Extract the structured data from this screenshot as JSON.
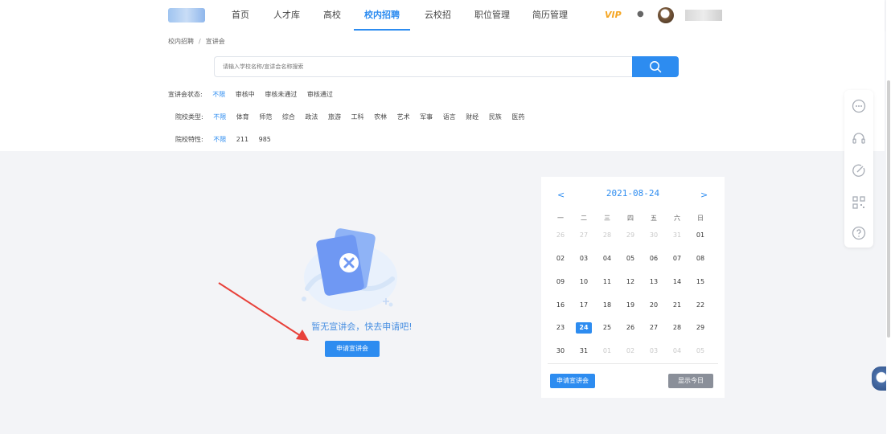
{
  "nav": {
    "items": [
      "首页",
      "人才库",
      "高校",
      "校内招聘",
      "云校招",
      "职位管理",
      "简历管理"
    ],
    "active_index": 3,
    "vip_label": "VIP"
  },
  "breadcrumb": [
    "校内招聘",
    "宣讲会"
  ],
  "breadcrumb_sep": "/",
  "search": {
    "placeholder": "请输入学校名称/宣讲会名称搜索"
  },
  "filters": {
    "status": {
      "label": "宣讲会状态:",
      "options": [
        "不限",
        "审核中",
        "审核未通过",
        "审核通过"
      ],
      "selected": 0
    },
    "school_type": {
      "label": "院校类型:",
      "options": [
        "不限",
        "体育",
        "师范",
        "综合",
        "政法",
        "旅游",
        "工科",
        "农林",
        "艺术",
        "军事",
        "语言",
        "财经",
        "民族",
        "医药"
      ],
      "selected": 0
    },
    "school_feature": {
      "label": "院校特性:",
      "options": [
        "不限",
        "211",
        "985"
      ],
      "selected": 0
    }
  },
  "empty_state": {
    "message": "暂无宣讲会，快去申请吧!",
    "button": "申请宣讲会"
  },
  "calendar": {
    "title": "2021-08-24",
    "prev": "<",
    "next": ">",
    "weekdays": [
      "一",
      "二",
      "三",
      "四",
      "五",
      "六",
      "日"
    ],
    "rows": [
      [
        "26",
        "27",
        "28",
        "29",
        "30",
        "31",
        "01"
      ],
      [
        "02",
        "03",
        "04",
        "05",
        "06",
        "07",
        "08"
      ],
      [
        "09",
        "10",
        "11",
        "12",
        "13",
        "14",
        "15"
      ],
      [
        "16",
        "17",
        "18",
        "19",
        "20",
        "21",
        "22"
      ],
      [
        "23",
        "24",
        "25",
        "26",
        "27",
        "28",
        "29"
      ],
      [
        "30",
        "31",
        "01",
        "02",
        "03",
        "04",
        "05"
      ]
    ],
    "muted": [
      [
        0,
        0
      ],
      [
        0,
        1
      ],
      [
        0,
        2
      ],
      [
        0,
        3
      ],
      [
        0,
        4
      ],
      [
        0,
        5
      ],
      [
        5,
        2
      ],
      [
        5,
        3
      ],
      [
        5,
        4
      ],
      [
        5,
        5
      ],
      [
        5,
        6
      ]
    ],
    "today": [
      4,
      1
    ],
    "apply_button": "申请宣讲会",
    "today_button": "显示今日"
  },
  "tools": [
    "chat-icon",
    "headset-icon",
    "feedback-icon",
    "qrcode-icon",
    "help-icon"
  ],
  "colors": {
    "accent": "#2d8cf0",
    "arrow": "#e8413a",
    "muted_button": "#8a8f99"
  }
}
